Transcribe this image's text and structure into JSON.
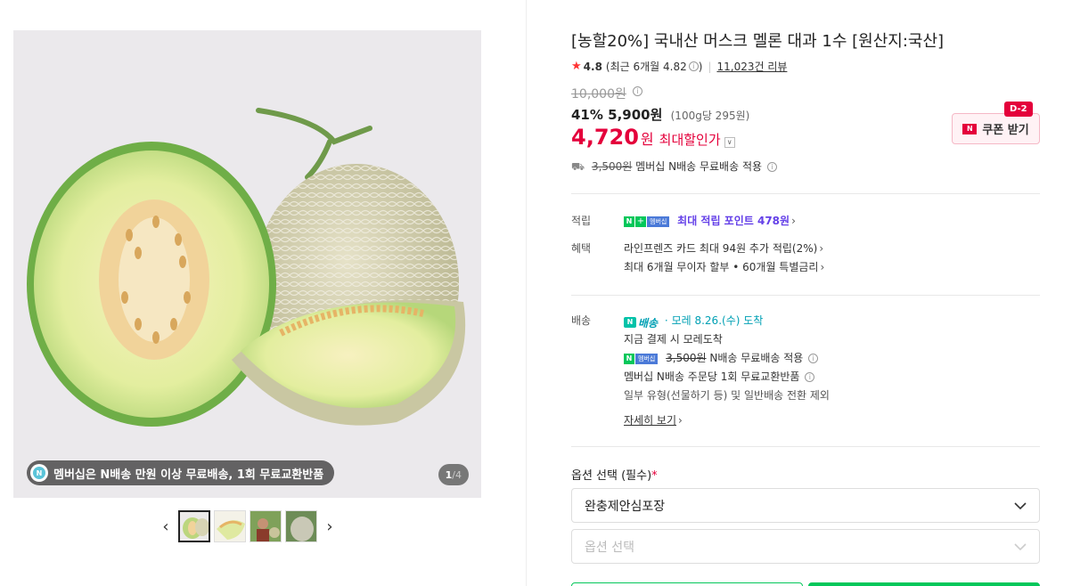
{
  "gallery": {
    "promo_badge": "N",
    "promo_text": "멤버십은 N배송 만원 이상 무료배송, 1회 무료교환반품",
    "counter_current": "1",
    "counter_total": "/4",
    "prev_arrow": "‹",
    "next_arrow": "›",
    "thumbnails": [
      "melon-cut-thumb",
      "melon-slice-thumb",
      "farmer-thumb",
      "melon-whole-thumb"
    ]
  },
  "product": {
    "title": "[농할20%] 국내산 머스크 멜론 대과 1수 [원산지:국산]",
    "rating_star": "★",
    "rating": "4.8",
    "rating_recent": "(최근 6개월 4.82",
    "rating_recent_close": ")",
    "review_count": "11,023건 리뷰",
    "original_price": "10,000원",
    "discount_rate": "41%",
    "sale_price": "5,900원",
    "unit_price": "(100g당 295원)",
    "max_discount_amount": "4,720",
    "max_discount_won": "원",
    "max_discount_label": "최대할인가",
    "shipping_strike": "3,500원",
    "shipping_text": "멤버십 N배송 무료배송 적용",
    "coupon_label": "쿠폰 받기",
    "coupon_dday": "D-2"
  },
  "benefits": {
    "points_label": "적립",
    "points_text": "최대 적립 포인트 478원",
    "benefit_label": "혜택",
    "benefit_line1": "라인프렌즈 카드 최대 94원 추가 적립(2%)",
    "benefit_line2": "최대 6개월 무이자 할부 • 60개월 특별금리"
  },
  "delivery": {
    "label": "배송",
    "n_delivery": "배송",
    "arrival": "모레 8.26.(수) 도착",
    "line1": "지금 결제 시 모레도착",
    "line2_strike": "3,500원",
    "line2_text": "N배송 무료배송 적용",
    "line3": "멤버십 N배송 주문당 1회 무료교환반품",
    "line4": "일부 유형(선물하기 등) 및 일반배송 전환 제외",
    "detail_link": "자세히 보기"
  },
  "options": {
    "label": "옵션 선택 (필수)",
    "required_mark": "*",
    "select1_value": "완충제안심포장",
    "select2_placeholder": "옵션 선택"
  },
  "colors": {
    "accent_red": "#e4003b",
    "naver_green": "#03c75a",
    "points_purple": "#6440e8",
    "delivery_teal": "#00a0b4"
  }
}
